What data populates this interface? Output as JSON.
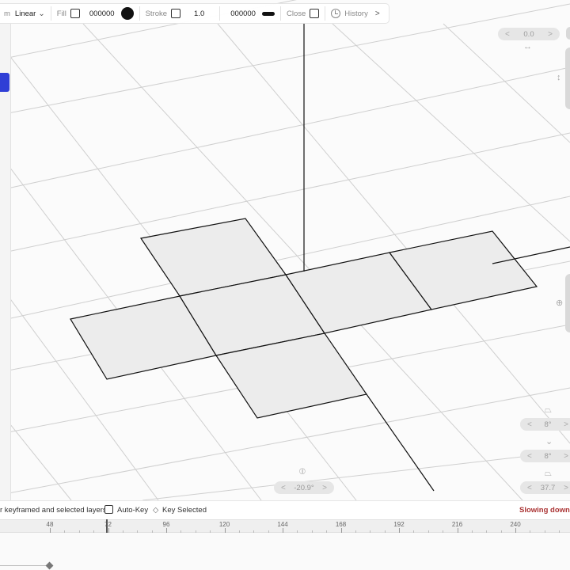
{
  "toolbar": {
    "mode_fragment": "m",
    "interpolation": "Linear",
    "fill_label": "Fill",
    "fill_color_hex": "000000",
    "stroke_label": "Stroke",
    "stroke_width": "1.0",
    "stroke_color_hex": "000000",
    "close_label": "Close",
    "history_label": "History"
  },
  "controls": {
    "top_pill_value": "0.0",
    "bottom_pill_value": "-20.9°",
    "right_pill_1_value": "8°",
    "right_pill_2_value": "8°",
    "right_pill_3_value": "37.7"
  },
  "icons": {
    "horizontal_arrows": "↔",
    "vertical_arrows": "↕",
    "rotate_y": "⊕",
    "rotate_x": "⦶",
    "trapezoid": "⏢",
    "chevron_left": "<",
    "chevron_right": ">"
  },
  "timeline": {
    "filter_text": "r keyframed and selected layers",
    "auto_key_label": "Auto-Key",
    "key_selected_label": "Key Selected",
    "status_text": "Slowing down",
    "ruler_ticks": [
      "48",
      "72",
      "96",
      "120",
      "144",
      "168",
      "192",
      "216",
      "240"
    ]
  },
  "colors": {
    "accent": "#2f3fd6",
    "status": "#a33333",
    "face_fill": "#ececec",
    "line": "#111111"
  }
}
